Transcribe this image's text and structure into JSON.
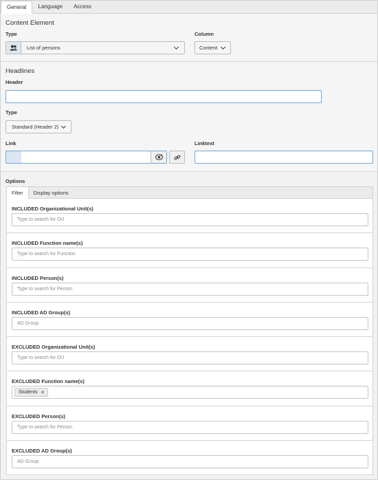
{
  "tabs": [
    "General",
    "Language",
    "Access"
  ],
  "content_element": {
    "title": "Content Element",
    "type_label": "Type",
    "type_value": "List of persons",
    "column_label": "Column",
    "column_value": "Content"
  },
  "headlines": {
    "title": "Headlines",
    "header_label": "Header",
    "header_value": "",
    "type_label": "Type",
    "type_value": "Standard (Header 2)",
    "link_label": "Link",
    "link_value": "",
    "linktext_label": "Linktext",
    "linktext_value": ""
  },
  "options": {
    "title": "Options",
    "tabs": [
      "Filter",
      "Display options"
    ],
    "fields": [
      {
        "label": "INCLUDED Organizational Unit(s)",
        "placeholder": "Type to search for OU"
      },
      {
        "label": "INCLUDED Function name(s)",
        "placeholder": "Type to search for Function"
      },
      {
        "label": "INCLUDED Person(s)",
        "placeholder": "Type to search for Person"
      },
      {
        "label": "INCLUDED AD Group(s)",
        "placeholder": "AD Group"
      },
      {
        "label": "EXCLUDED Organizational Unit(s)",
        "placeholder": "Type to search for OU"
      },
      {
        "label": "EXCLUDED Function name(s)",
        "placeholder": "",
        "chip": "Students",
        "chip_remove": "×"
      },
      {
        "label": "EXCLUDED Person(s)",
        "placeholder": "Type to search for Person"
      },
      {
        "label": "EXCLUDED AD Group(s)",
        "placeholder": "AD Group"
      }
    ]
  },
  "icons": {
    "type_icon": "users-icon",
    "link_browse_icon": "link-browser-icon",
    "link_icon": "chain-link-icon"
  }
}
